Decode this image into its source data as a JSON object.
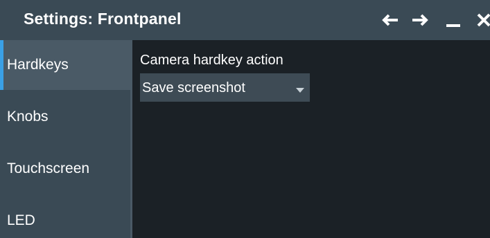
{
  "window": {
    "title": "Settings: Frontpanel",
    "controls": [
      "back-arrow-icon",
      "forward-arrow-icon",
      "minimize-icon",
      "close-icon"
    ]
  },
  "sidebar": {
    "items": [
      {
        "label": "Hardkeys",
        "active": true
      },
      {
        "label": "Knobs",
        "active": false
      },
      {
        "label": "Touchscreen",
        "active": false
      },
      {
        "label": "LED",
        "active": false
      }
    ]
  },
  "main": {
    "camera_hardkey_label": "Camera hardkey action",
    "camera_hardkey_value": "Save screenshot"
  },
  "colors": {
    "titlebar": "#3a4a55",
    "sidebar": "#3a4a55",
    "content_bg": "#1b2126",
    "accent": "#3aa0e6",
    "select_bg": "#3e4b55"
  }
}
